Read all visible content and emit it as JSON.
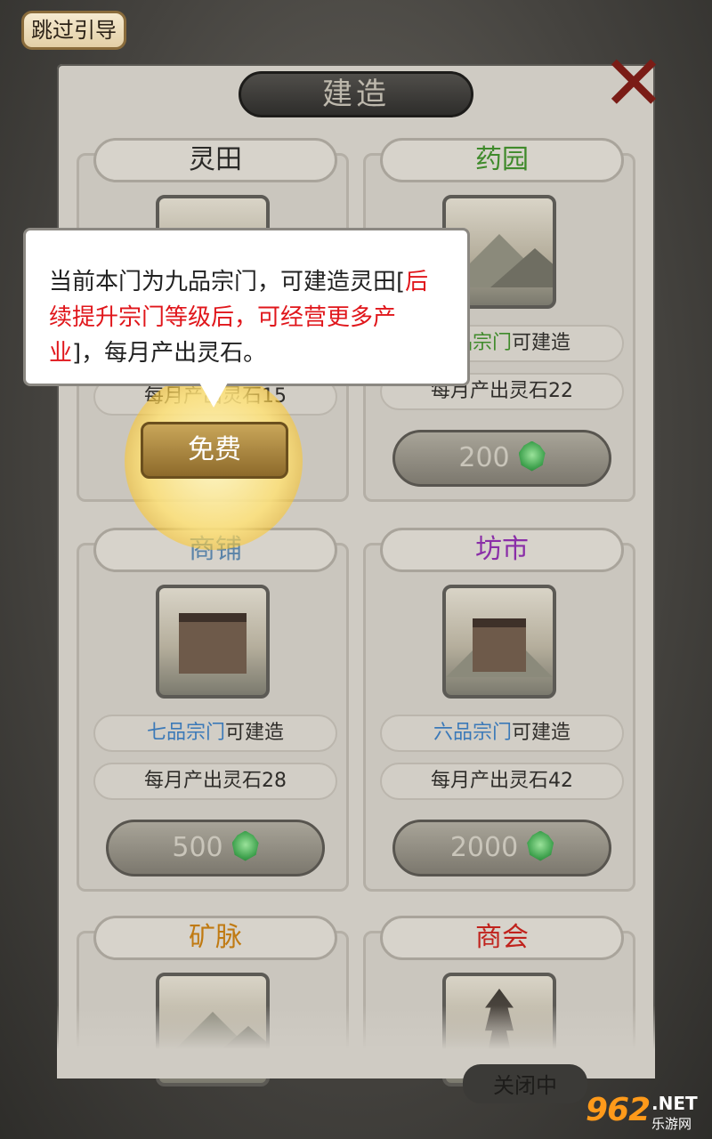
{
  "header": {
    "skip_label": "跳过引导",
    "title": "建造",
    "close_icon": "close-x-icon"
  },
  "tooltip": {
    "text_part1": "当前本门为九品宗门，可建造灵田[",
    "text_red": "后续提升宗门等级后，可经营更多产业",
    "text_part2": "]，每月产出灵石。"
  },
  "cards": [
    {
      "title": "灵田",
      "title_color": "#2b2a28",
      "income": "每月产出灵石15",
      "button": "免费",
      "button_highlighted": true
    },
    {
      "title": "药园",
      "title_color": "#3f8a2b",
      "requirement_rank": "八品宗门",
      "requirement_rank_color": "#3f8a2b",
      "requirement_suffix": "可建造",
      "income": "每月产出灵石22",
      "cost": "200",
      "cost_icon": "spirit-stone-icon"
    },
    {
      "title": "商铺",
      "title_color": "#5a83a8",
      "requirement_rank": "七品宗门",
      "requirement_rank_color": "#3b79b8",
      "requirement_suffix": "可建造",
      "income": "每月产出灵石28",
      "cost": "500",
      "cost_icon": "spirit-stone-icon"
    },
    {
      "title": "坊市",
      "title_color": "#8a2ea8",
      "requirement_rank": "六品宗门",
      "requirement_rank_color": "#3b79b8",
      "requirement_suffix": "可建造",
      "income": "每月产出灵石42",
      "cost": "2000",
      "cost_icon": "spirit-stone-icon"
    },
    {
      "title": "矿脉",
      "title_color": "#c07a12"
    },
    {
      "title": "商会",
      "title_color": "#c0221c"
    }
  ],
  "bottom_partial_label": "关闭中",
  "watermark": {
    "logo": "962",
    "net": ".NET",
    "cn": "乐游网"
  }
}
